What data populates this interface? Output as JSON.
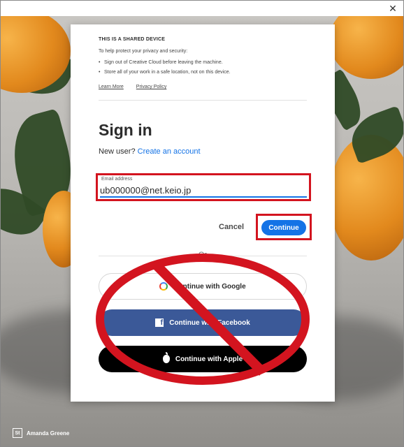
{
  "window": {
    "close_glyph": "✕"
  },
  "notice": {
    "title": "THIS IS A SHARED DEVICE",
    "text": "To help protect your privacy and security:",
    "bullets": [
      "Sign out of Creative Cloud before leaving the machine.",
      "Store all of your work in a safe location, not on this device."
    ],
    "learn_more": "Learn More",
    "privacy_policy": "Privacy Policy"
  },
  "signin": {
    "title": "Sign in",
    "new_user_text": "New user?",
    "create_account": "Create an account",
    "email_label": "Email address",
    "email_value": "ub000000@net.keio.jp",
    "cancel_label": "Cancel",
    "continue_label": "Continue",
    "or_text": "Or"
  },
  "social": {
    "google_label": "Continue with Google",
    "facebook_label": "Continue with Facebook",
    "apple_label": "Continue with Apple"
  },
  "credit": {
    "badge": "St",
    "name": "Amanda Greene"
  },
  "colors": {
    "accent": "#1473e6",
    "annotation_red": "#d3141f",
    "facebook": "#3b5998",
    "apple": "#000000"
  },
  "icons": [
    "close-icon",
    "google-icon",
    "facebook-icon",
    "apple-icon",
    "stock-badge-icon"
  ]
}
